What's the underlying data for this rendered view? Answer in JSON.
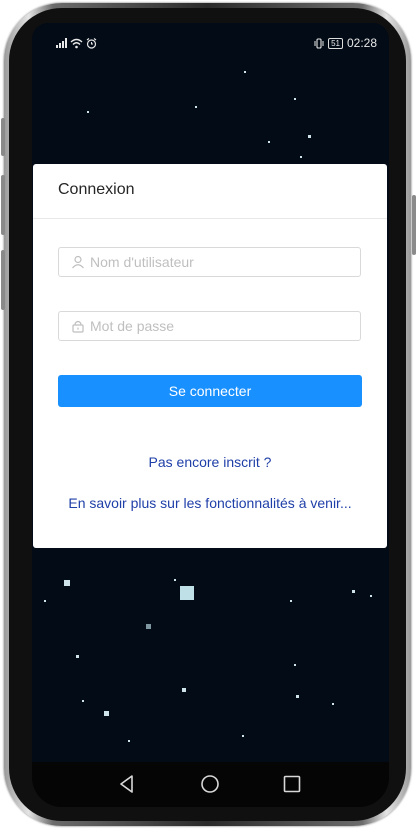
{
  "status_bar": {
    "time": "02:28",
    "battery": "51",
    "icons": [
      "signal-icon",
      "wifi-icon",
      "alarm-icon",
      "vibrate-icon",
      "battery-icon"
    ]
  },
  "login": {
    "title": "Connexion",
    "username_placeholder": "Nom d'utilisateur",
    "password_placeholder": "Mot de passe",
    "submit_label": "Se connecter",
    "register_link": "Pas encore inscrit ?",
    "more_link": "En savoir plus sur les fonctionnalités à venir..."
  },
  "nav": {
    "icons": [
      "back-icon",
      "home-icon",
      "recents-icon"
    ]
  },
  "colors": {
    "background": "#020b16",
    "primary_button": "#1890ff",
    "link": "#1f3fa8",
    "card": "#ffffff"
  }
}
